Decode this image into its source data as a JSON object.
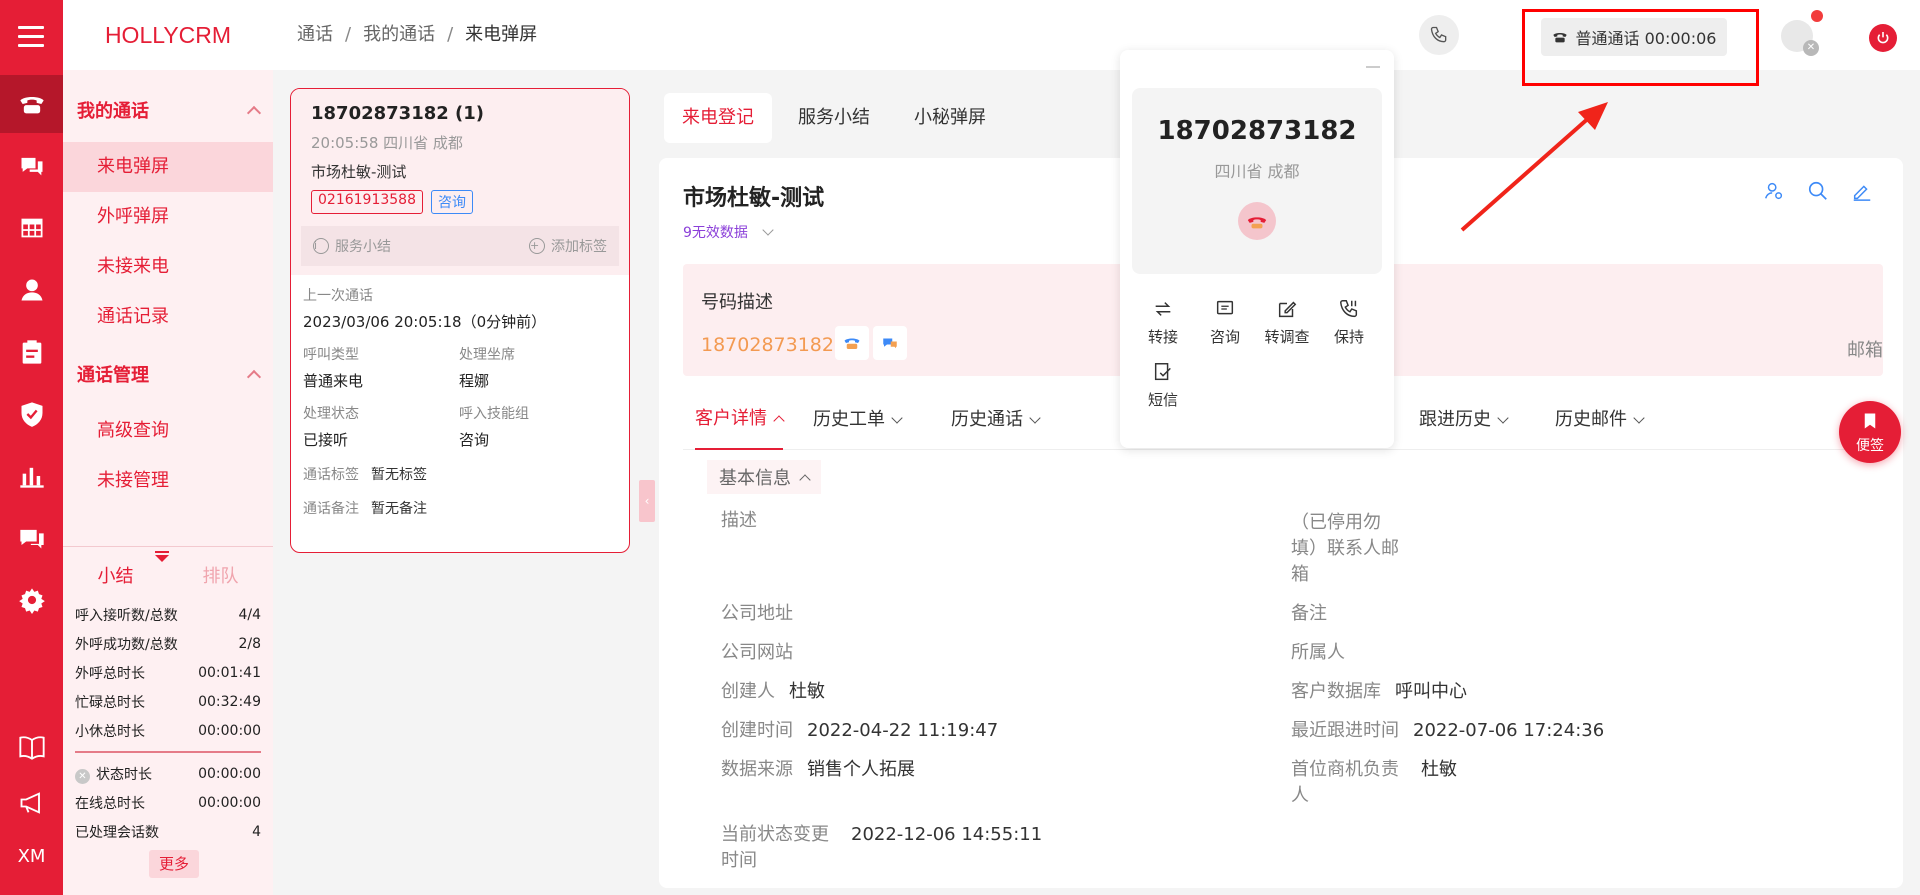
{
  "app": {
    "brand": "HOLLYCRM",
    "footer_user": "XM"
  },
  "nav": {
    "group1": "我的通话",
    "group1_items": [
      "来电弹屏",
      "外呼弹屏",
      "未接来电",
      "通话记录"
    ],
    "group2": "通话管理",
    "group2_items": [
      "高级查询",
      "未接管理"
    ]
  },
  "stats": {
    "tab_on": "小结",
    "tab_off": "排队",
    "rows": [
      {
        "k": "呼入接听数/总数",
        "v": "4/4"
      },
      {
        "k": "外呼成功数/总数",
        "v": "2/8"
      },
      {
        "k": "外呼总时长",
        "v": "00:01:41"
      },
      {
        "k": "忙碌总时长",
        "v": "00:32:49"
      },
      {
        "k": "小休总时长",
        "v": "00:00:00"
      },
      {
        "k": "状态时长",
        "v": "00:00:00"
      },
      {
        "k": "在线总时长",
        "v": "00:00:00"
      },
      {
        "k": "已处理会话数",
        "v": "4"
      }
    ],
    "more": "更多"
  },
  "topbar": {
    "crumbs": [
      "通话",
      "我的通话",
      "来电弹屏"
    ],
    "call_status": "普通通话 00:00:06"
  },
  "call_card": {
    "number": "18702873182 (1)",
    "time_loc": "20:05:58 四川省 成都",
    "name": "市场杜敏-测试",
    "tag_red": "02161913588",
    "tag_blue": "咨询",
    "service_summary": "服务小结",
    "add_tag": "添加标签",
    "last_call_label": "上一次通话",
    "last_call_value": "2023/03/06 20:05:18（0分钟前）",
    "call_type_label": "呼叫类型",
    "call_type_value": "普通来电",
    "seat_label": "处理坐席",
    "seat_value": "程娜",
    "status_label": "处理状态",
    "status_value": "已接听",
    "skill_label": "呼入技能组",
    "skill_value": "咨询",
    "tag_label": "通话标签",
    "tag_value": "暂无标签",
    "note_label": "通话备注",
    "note_value": "暂无备注"
  },
  "main_tabs": [
    "来电登记",
    "服务小结",
    "小秘弹屏"
  ],
  "customer": {
    "title": "市场杜敏-测试",
    "sub": "9无效数据",
    "num_desc_label": "号码描述",
    "num": "18702873182",
    "mail_label": "邮箱",
    "detail_tabs": [
      "客户详情",
      "历史工单",
      "历史通话",
      "跟进历史",
      "历史邮件"
    ],
    "basic_info": "基本信息",
    "fields": {
      "desc": "描述",
      "stopped_mail_l1": "（已停用勿",
      "stopped_mail_l2": "填）联系人邮",
      "stopped_mail_l3": "箱",
      "address": "公司地址",
      "remark": "备注",
      "website": "公司网站",
      "owner": "所属人",
      "creator_k": "创建人",
      "creator_v": "杜敏",
      "db_k": "客户数据库",
      "db_v": "呼叫中心",
      "ctime_k": "创建时间",
      "ctime_v": "2022-04-22 11:19:47",
      "ftime_k": "最近跟进时间",
      "ftime_v": "2022-07-06 17:24:36",
      "source_k": "数据来源",
      "source_v": "销售个人拓展",
      "lead_k1": "首位商机负责",
      "lead_k2": "人",
      "lead_v": "杜敏",
      "state_k1": "当前状态变更",
      "state_k2": "时间",
      "state_v": "2022-12-06 14:55:11"
    }
  },
  "popup": {
    "number": "18702873182",
    "location": "四川省 成都",
    "actions": [
      "转接",
      "咨询",
      "转调查",
      "保持",
      "短信"
    ]
  },
  "sticky": "便签",
  "colors": {
    "brand": "#e51e36",
    "highlight": "#ff0000"
  }
}
